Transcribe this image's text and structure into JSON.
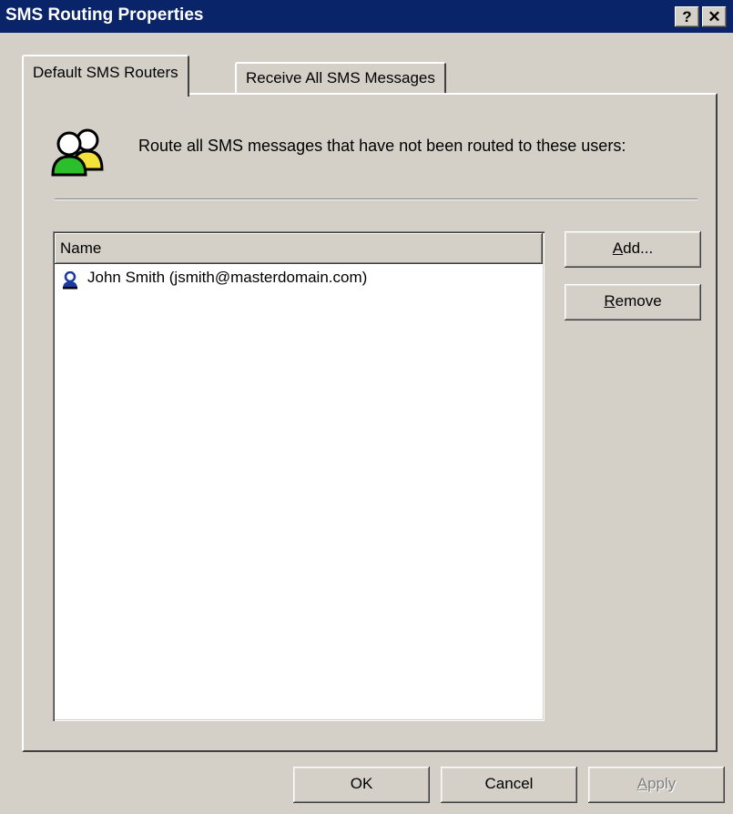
{
  "window": {
    "title": "SMS Routing Properties",
    "help_glyph": "?",
    "close_glyph": "✕"
  },
  "tabs": [
    {
      "label": "Default SMS Routers",
      "active": true
    },
    {
      "label": "Receive All SMS Messages",
      "active": false
    }
  ],
  "description": "Route all SMS messages that have not been routed to these users:",
  "list": {
    "column_header": "Name",
    "rows": [
      {
        "name": "John Smith (jsmith@masterdomain.com)",
        "icon": "user-icon"
      }
    ]
  },
  "buttons": {
    "add": {
      "mnemonic": "A",
      "rest": "dd..."
    },
    "remove": {
      "mnemonic": "R",
      "rest": "emove"
    },
    "ok": "OK",
    "cancel": "Cancel",
    "apply": {
      "mnemonic": "A",
      "rest": "pply",
      "enabled": false
    }
  },
  "colors": {
    "titlebar": "#0a246a",
    "face": "#d4d0c8",
    "user_icon": "#1a3aa0",
    "group_icon_green": "#2cbf2c",
    "group_icon_yellow": "#f2e23a"
  }
}
